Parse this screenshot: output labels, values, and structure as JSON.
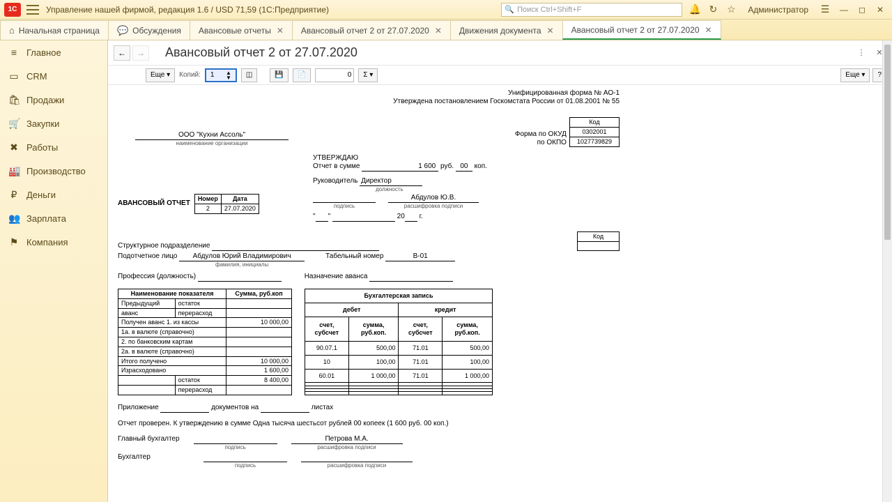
{
  "app": {
    "title": "Управление нашей фирмой, редакция 1.6 / USD 71,59  (1С:Предприятие)",
    "search_placeholder": "Поиск Ctrl+Shift+F",
    "admin": "Администратор"
  },
  "tabs": [
    {
      "icon": "⌂",
      "label": "Начальная страница",
      "closable": false
    },
    {
      "icon": "💬",
      "label": "Обсуждения",
      "closable": false,
      "iconcolor": "#2a9b4a"
    },
    {
      "icon": "",
      "label": "Авансовые отчеты",
      "closable": true
    },
    {
      "icon": "",
      "label": "Авансовый отчет 2 от 27.07.2020",
      "closable": true
    },
    {
      "icon": "",
      "label": "Движения документа",
      "closable": true
    },
    {
      "icon": "",
      "label": "Авансовый отчет 2 от 27.07.2020",
      "closable": true,
      "active": true
    }
  ],
  "sidebar": [
    {
      "icon": "≡",
      "label": "Главное"
    },
    {
      "icon": "▭",
      "label": "CRM"
    },
    {
      "icon": "🛍",
      "label": "Продажи"
    },
    {
      "icon": "🛒",
      "label": "Закупки"
    },
    {
      "icon": "✖",
      "label": "Работы"
    },
    {
      "icon": "🏭",
      "label": "Производство"
    },
    {
      "icon": "₽",
      "label": "Деньги"
    },
    {
      "icon": "👥",
      "label": "Зарплата"
    },
    {
      "icon": "⚑",
      "label": "Компания"
    }
  ],
  "doc": {
    "title": "Авансовый отчет 2 от 27.07.2020",
    "toolbar": {
      "more": "Еще ▾",
      "copies": "Копий:",
      "copies_val": "1",
      "zero": "0",
      "sigma": "Σ ▾",
      "help": "?"
    }
  },
  "form": {
    "header1": "Унифицированная форма № АО-1",
    "header2": "Утверждена постановлением Госкомстата России от  01.08.2001 № 55",
    "kod_label": "Код",
    "okud_label": "Форма по ОКУД",
    "okud": "0302001",
    "okpo_label": "по ОКПО",
    "okpo": "1027739829",
    "org": "ООО \"Кухни Ассоль\"",
    "org_sub": "наименование организации",
    "approve": "УТВЕРЖДАЮ",
    "report_sum_label": "Отчет в сумме",
    "report_sum": "1 600",
    "rub": "руб.",
    "kop_val": "00",
    "kop": "коп.",
    "ruk": "Руководитель",
    "ruk_pos": "Директор",
    "ruk_pos_sub": "должность",
    "ruk_name": "Абдулов Ю.В.",
    "sign_sub": "подпись",
    "decode_sub": "расшифровка подписи",
    "year20": "20",
    "yearg": "г.",
    "title": "АВАНСОВЫЙ ОТЧЕТ",
    "num_label": "Номер",
    "num": "2",
    "date_label": "Дата",
    "date": "27.07.2020",
    "struct_label": "Структурное подразделение",
    "tab_label": "Табельный номер",
    "tab_num": "В-01",
    "person_label": "Подотчетное лицо",
    "person": "Абдулов Юрий Владимирович",
    "person_sub": "фамилия, инициалы",
    "prof_label": "Профессия (должность)",
    "purpose_label": "Назначение аванса",
    "left_table": {
      "h1": "Наименование показателя",
      "h2": "Сумма, руб.коп",
      "rows": [
        [
          "Предыдущий",
          "остаток",
          ""
        ],
        [
          "аванс",
          "перерасход",
          ""
        ],
        [
          "Получен аванс 1. из кассы",
          "",
          "10 000,00"
        ],
        [
          "1а. в валюте (справочно)",
          "",
          ""
        ],
        [
          "2. по банковским картам",
          "",
          ""
        ],
        [
          "2а. в валюте (справочно)",
          "",
          ""
        ],
        [
          "Итого получено",
          "",
          "10 000,00"
        ],
        [
          "Израсходовано",
          "",
          "1 600,00"
        ],
        [
          "",
          "остаток",
          "8 400,00"
        ],
        [
          "",
          "перерасход",
          ""
        ]
      ]
    },
    "right_table": {
      "h": "Бухгалтерская запись",
      "h_deb": "дебет",
      "h_cred": "кредит",
      "sub": "счет, субсчет",
      "sub2": "сумма, руб.коп.",
      "rows": [
        [
          "90.07.1",
          "500,00",
          "71.01",
          "500,00"
        ],
        [
          "10",
          "100,00",
          "71.01",
          "100,00"
        ],
        [
          "60.01",
          "1 000,00",
          "71.01",
          "1 000,00"
        ],
        [
          "",
          "",
          "",
          ""
        ],
        [
          "",
          "",
          "",
          ""
        ],
        [
          "",
          "",
          "",
          ""
        ],
        [
          "",
          "",
          "",
          ""
        ]
      ]
    },
    "attach": "Приложение",
    "attach2": "документов на",
    "attach3": "листах",
    "checked": "Отчет проверен. К утверждению в сумме Одна тысяча шестьсот рублей 00 копеек (1 600 руб. 00 коп.)",
    "glbuh": "Главный бухгалтер",
    "glbuh_name": "Петрова М.А.",
    "buh": "Бухгалтер"
  }
}
